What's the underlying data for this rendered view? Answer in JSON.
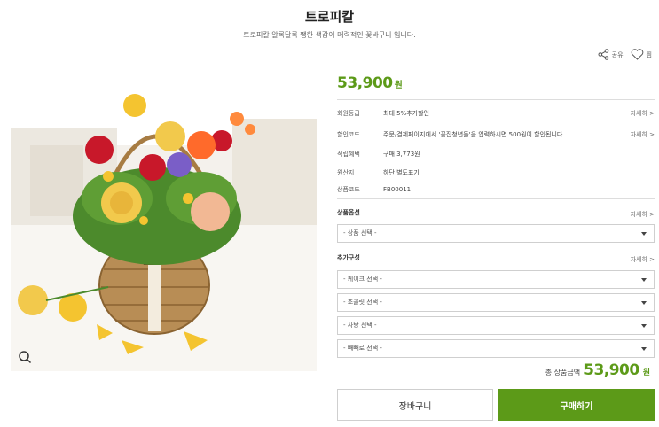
{
  "product": {
    "title": "트로피칼",
    "subtitle": "트로피칼 알록달록 쨍한 색감이 매력적인 꽃바구니 입니다."
  },
  "share": {
    "share_label": "공유",
    "wish_label": "찜"
  },
  "price": {
    "amount": "53,900",
    "unit": "원"
  },
  "info": {
    "member_grade": {
      "label": "회원등급",
      "value": "최대 5%추가할인",
      "more": "자세히 >"
    },
    "discount_code": {
      "label": "할인코드",
      "value": "주문/결제페이지에서 '꽃집청년들'을 입력하시면 500원이 할인됩니다.",
      "more": "자세히 >"
    },
    "points": {
      "label": "적립혜택",
      "value": "구매 3,773원"
    },
    "origin": {
      "label": "원산지",
      "value": "하단 별도표기"
    },
    "code": {
      "label": "상품코드",
      "value": "FB00011"
    }
  },
  "options": {
    "label": "상품옵션",
    "more": "자세히 >",
    "select": "- 상품 선택 -"
  },
  "addons": {
    "label": "추가구성",
    "more": "자세히 >",
    "selects": [
      "- 케이크 선택 -",
      "- 초콜릿 선택 -",
      "- 사탕 선택 -",
      "- 빼빼로 선택 -"
    ]
  },
  "total": {
    "label": "총 상품금액",
    "amount": "53,900",
    "unit": "원"
  },
  "buttons": {
    "cart": "장바구니",
    "buy": "구매하기"
  },
  "icons": {
    "share": "share-icon",
    "heart": "heart-icon",
    "zoom": "magnifier-icon"
  },
  "colors": {
    "accent": "#5c9a18",
    "border": "#cfcfcf"
  }
}
